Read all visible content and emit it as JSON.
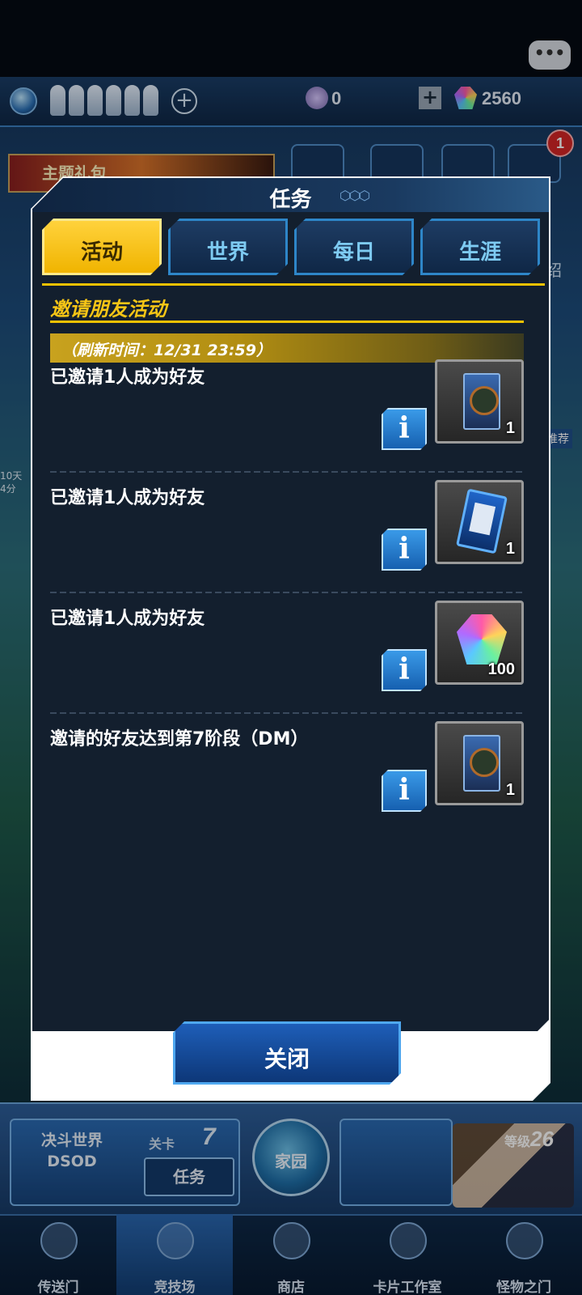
{
  "hud": {
    "orb_count": "0",
    "gems": "2560",
    "notification_count": "1",
    "banner_text": "主题礼包",
    "side_right_label": "绍",
    "side_right_tag": "推荐",
    "side_left_text": "10天\n4分"
  },
  "modal": {
    "title": "任务",
    "tabs": [
      {
        "label": "活动",
        "active": true
      },
      {
        "label": "世界",
        "active": false
      },
      {
        "label": "每日",
        "active": false
      },
      {
        "label": "生涯",
        "active": false
      }
    ],
    "section_title": "邀请朋友活动",
    "refresh_text": "（刷新时间：12/31 23:59）",
    "missions": [
      {
        "text": "已邀请1人成为好友",
        "reward_icon": "card-pack-icon",
        "reward_qty": "1"
      },
      {
        "text": "已邀请1人成为好友",
        "reward_icon": "card-sleeve-icon",
        "reward_qty": "1"
      },
      {
        "text": "已邀请1人成为好友",
        "reward_icon": "gem-icon",
        "reward_qty": "100"
      },
      {
        "text": "邀请的好友达到第7阶段（DM）",
        "reward_icon": "card-pack-icon",
        "reward_qty": "1"
      }
    ],
    "info_label": "i",
    "close_label": "关闭"
  },
  "dashboard": {
    "duel_world": "决斗世界\nDSOD",
    "stage_label": "关卡",
    "stage_num": "7",
    "mission_button": "任务",
    "home_label": "家园",
    "level_label": "等级",
    "level_value": "26"
  },
  "nav": [
    {
      "label": "传送门",
      "icon": "gate-icon"
    },
    {
      "label": "竞技场",
      "icon": "swords-icon",
      "active": true
    },
    {
      "label": "商店",
      "icon": "cart-icon"
    },
    {
      "label": "卡片工作室",
      "icon": "cards-icon"
    },
    {
      "label": "怪物之门",
      "icon": "monster-gate-icon"
    }
  ],
  "colors": {
    "accent_yellow": "#f2c200",
    "panel_bg": "#131f2e",
    "button_blue": "#1e5eb8"
  }
}
